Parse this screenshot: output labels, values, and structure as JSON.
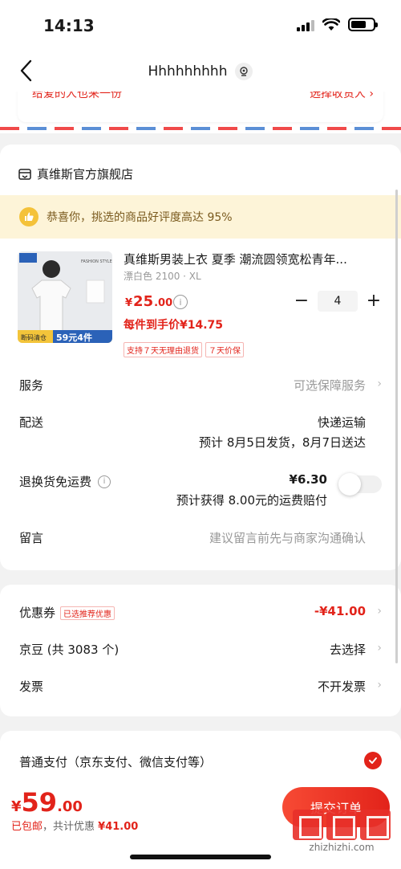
{
  "status": {
    "time": "14:13"
  },
  "nav": {
    "title": "Hhhhhhhhh"
  },
  "address": {
    "left_text": "给爱的人也来一份",
    "right_text": "选择收货人 ›"
  },
  "store": {
    "name": "真维斯官方旗舰店",
    "praise_text": "恭喜你，挑选的商品好评度高达 95%"
  },
  "product": {
    "title": "真维斯男装上衣 夏季 潮流圆领宽松青年...",
    "spec": "漂白色 2100 · XL",
    "price_symbol": "¥",
    "price_int": "25",
    "price_dec": ".00",
    "unit_price": "每件到手价¥14.75",
    "tags": [
      "支持７天无理由退货",
      "７天价保"
    ],
    "quantity": "4",
    "image": {
      "label_style": "FASHION STYLE",
      "promo": "59元4件",
      "promo_small": "断码清仓"
    }
  },
  "rows": {
    "service_label": "服务",
    "service_value": "可选保障服务",
    "delivery_label": "配送",
    "delivery_value": "快递运输",
    "delivery_detail": "预计 8月5日发货，8月7日送达",
    "return_label": "退换货免运费",
    "return_price": "¥6.30",
    "return_detail": "预计获得 8.00元的运费赔付",
    "note_label": "留言",
    "note_placeholder": "建议留言前先与商家沟通确认"
  },
  "coupons": {
    "coupon_label": "优惠券",
    "coupon_badge": "已选推荐优惠",
    "coupon_value": "-¥41.00",
    "beans_label": "京豆 (共 3083 个)",
    "beans_value": "去选择",
    "invoice_label": "发票",
    "invoice_value": "不开发票"
  },
  "payment": {
    "label": "普通支付（京东支付、微信支付等）"
  },
  "bottom": {
    "total_symbol": "¥",
    "total_int": "59",
    "total_dec": ".00",
    "shipping_free": "已包邮",
    "discount_prefix": "，共计优惠 ",
    "discount_value": "¥41.00",
    "submit_label": "提交订单",
    "watermark": "zhizhizhi.com"
  },
  "colors": {
    "accent": "#e2231a",
    "praise_bg": "#fdf4d8"
  }
}
